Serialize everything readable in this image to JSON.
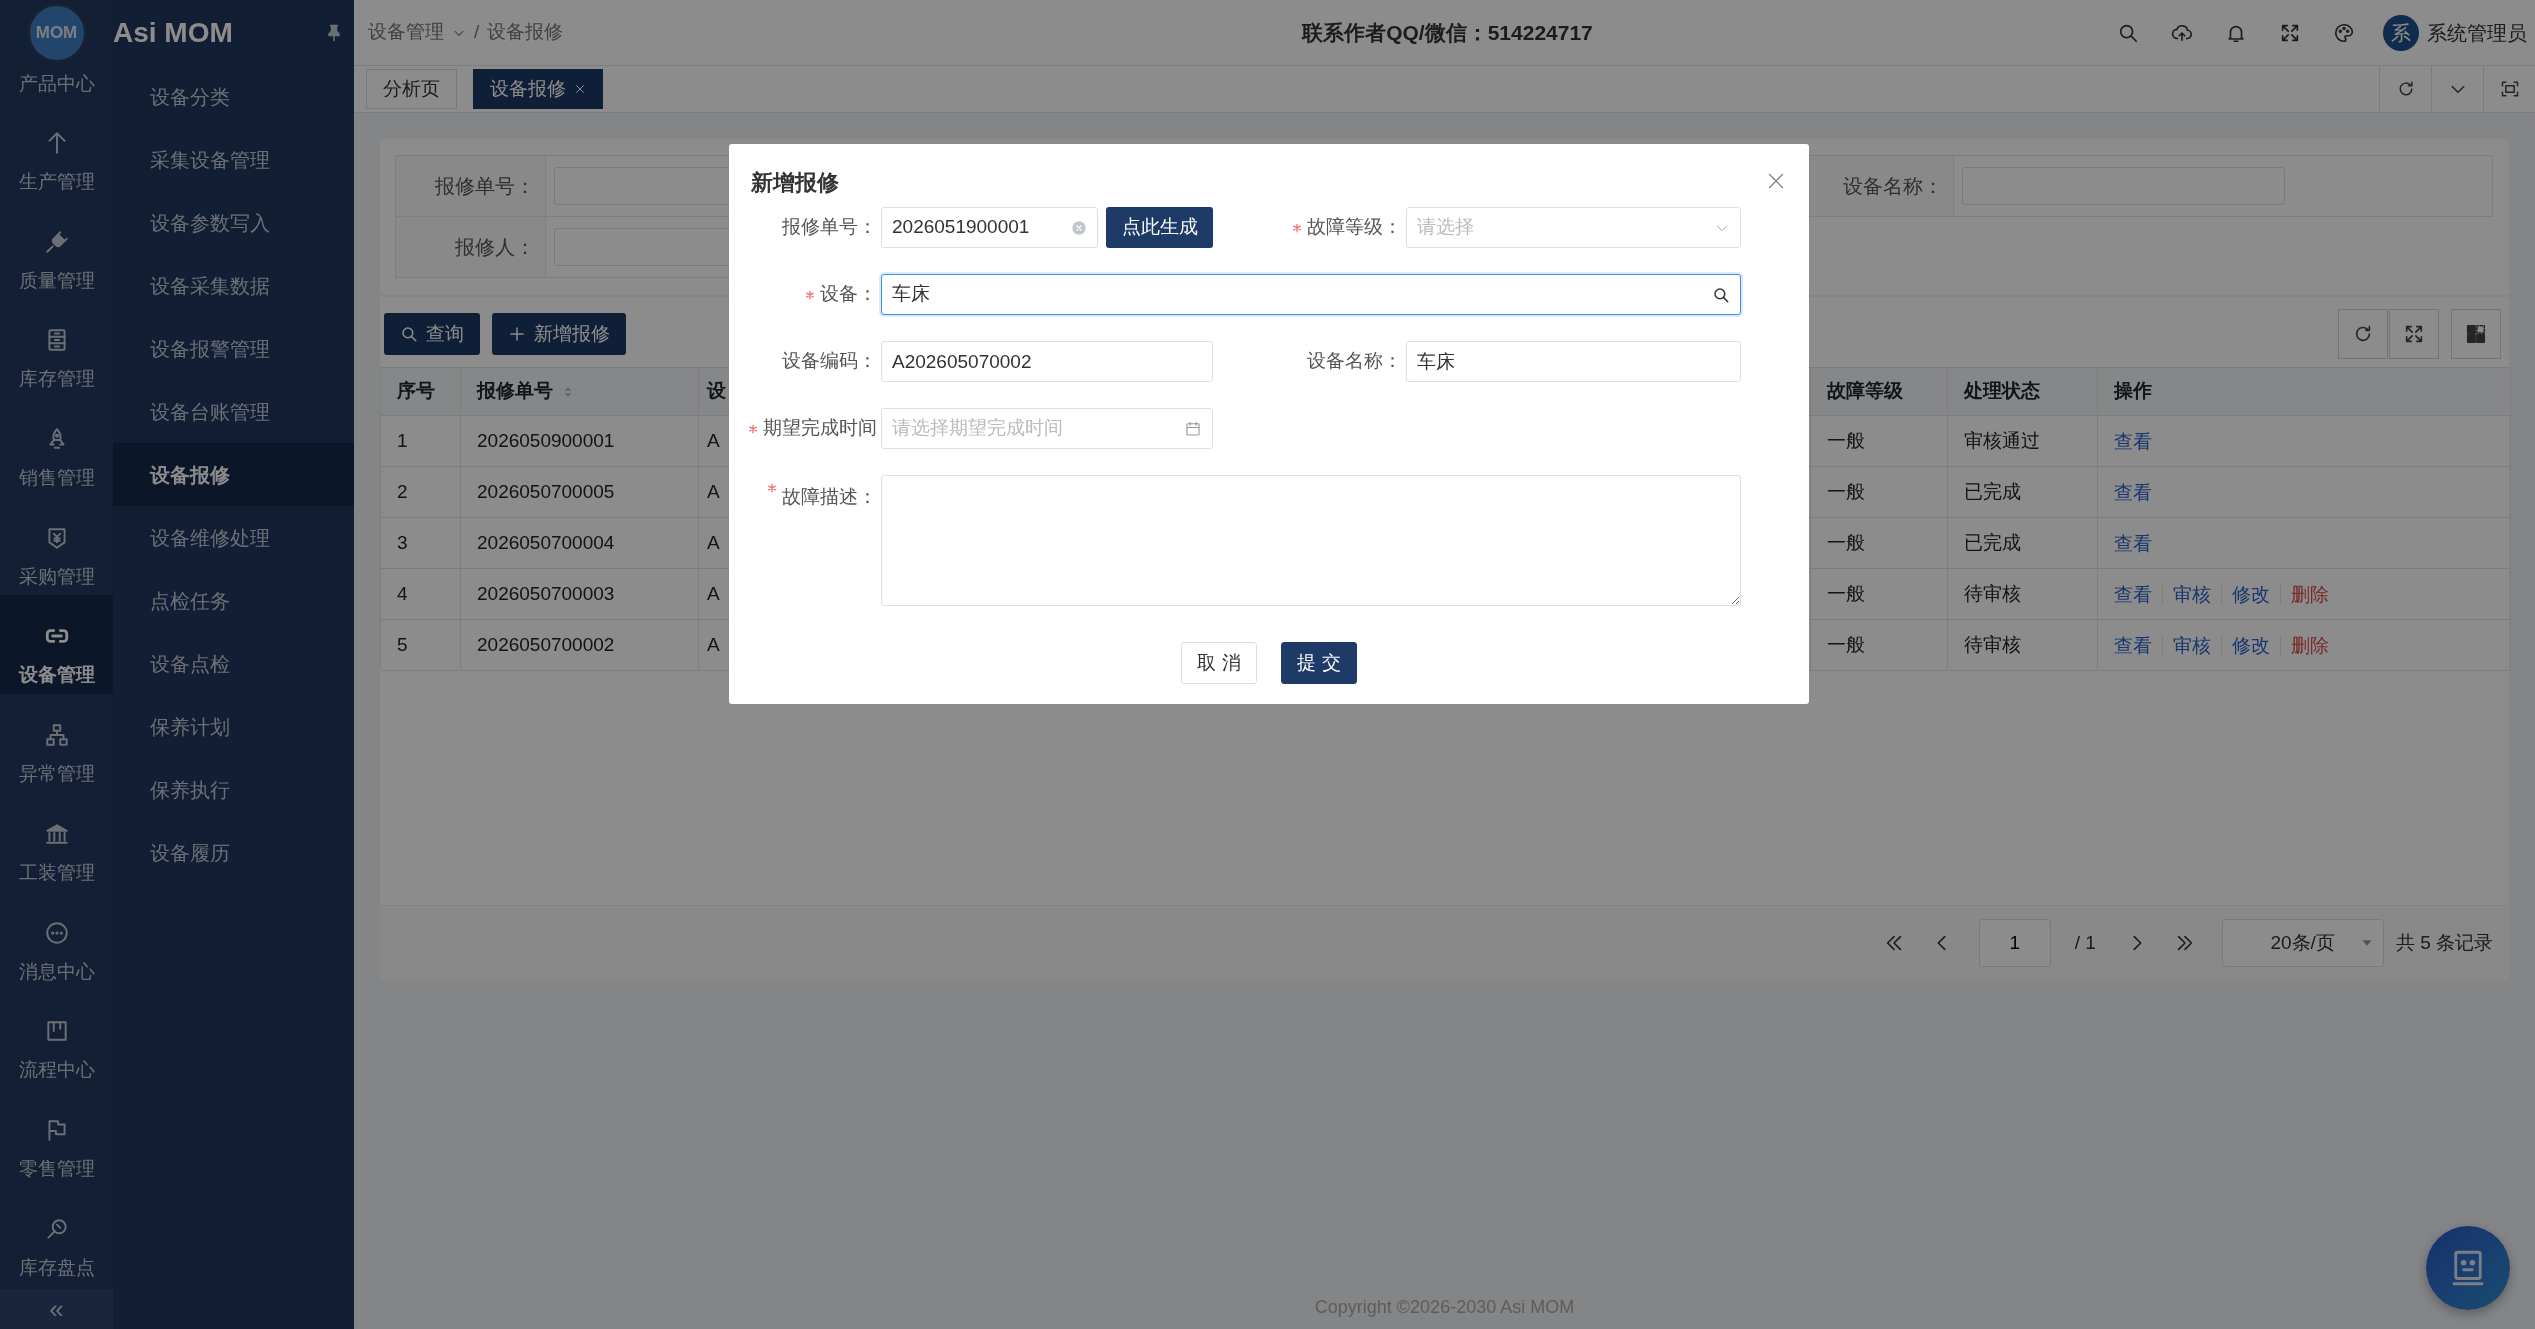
{
  "sidebar": {
    "logo": "MOM",
    "brand": "Asi MOM",
    "rail": [
      {
        "label": "产品中心",
        "selected": false
      },
      {
        "label": "生产管理",
        "selected": false
      },
      {
        "label": "质量管理",
        "selected": false
      },
      {
        "label": "库存管理",
        "selected": false
      },
      {
        "label": "销售管理",
        "selected": false
      },
      {
        "label": "采购管理",
        "selected": false
      },
      {
        "label": "设备管理",
        "selected": true
      },
      {
        "label": "异常管理",
        "selected": false
      },
      {
        "label": "工装管理",
        "selected": false
      },
      {
        "label": "消息中心",
        "selected": false
      },
      {
        "label": "流程中心",
        "selected": false
      },
      {
        "label": "零售管理",
        "selected": false
      },
      {
        "label": "库存盘点",
        "selected": false
      }
    ],
    "collapse": "«",
    "menu": [
      {
        "label": "设备分类",
        "selected": false
      },
      {
        "label": "采集设备管理",
        "selected": false
      },
      {
        "label": "设备参数写入",
        "selected": false
      },
      {
        "label": "设备采集数据",
        "selected": false
      },
      {
        "label": "设备报警管理",
        "selected": false
      },
      {
        "label": "设备台账管理",
        "selected": false
      },
      {
        "label": "设备报修",
        "selected": true
      },
      {
        "label": "设备维修处理",
        "selected": false
      },
      {
        "label": "点检任务",
        "selected": false
      },
      {
        "label": "设备点检",
        "selected": false
      },
      {
        "label": "保养计划",
        "selected": false
      },
      {
        "label": "保养执行",
        "selected": false
      },
      {
        "label": "设备履历",
        "selected": false
      }
    ]
  },
  "header": {
    "breadcrumb": [
      "设备管理",
      "/",
      "设备报修"
    ],
    "notice": "联系作者QQ/微信：514224717",
    "avatar": "系",
    "user": "系统管理员"
  },
  "tabs": [
    {
      "label": "分析页",
      "selected": false,
      "closable": false
    },
    {
      "label": "设备报修",
      "selected": true,
      "closable": true
    }
  ],
  "search_form": {
    "repair_no": {
      "label": "报修单号："
    },
    "equipment_name": {
      "label": "设备名称："
    },
    "reporter": {
      "label": "报修人："
    }
  },
  "actions": [
    {
      "label": "查询"
    },
    {
      "label": "新增报修"
    }
  ],
  "table": {
    "columns": [
      {
        "label": "序号",
        "sortable": false
      },
      {
        "label": "报修单号",
        "sortable": true
      },
      {
        "label": "设",
        "sortable": false
      },
      {
        "label": "故障等级",
        "sortable": false
      },
      {
        "label": "处理状态",
        "sortable": false
      },
      {
        "label": "操作",
        "sortable": false
      }
    ],
    "rows": [
      {
        "cells": [
          "1",
          "2026050900001",
          "A",
          "一般",
          "审核通过"
        ],
        "operations": [
          {
            "label": "查看",
            "kind": "link"
          }
        ]
      },
      {
        "cells": [
          "2",
          "2026050700005",
          "A",
          "一般",
          "已完成"
        ],
        "operations": [
          {
            "label": "查看",
            "kind": "link"
          }
        ]
      },
      {
        "cells": [
          "3",
          "2026050700004",
          "A",
          "一般",
          "已完成"
        ],
        "operations": [
          {
            "label": "查看",
            "kind": "link"
          }
        ]
      },
      {
        "cells": [
          "4",
          "2026050700003",
          "A",
          "一般",
          "待审核"
        ],
        "operations": [
          {
            "label": "查看",
            "kind": "link"
          },
          {
            "label": "审核",
            "kind": "link"
          },
          {
            "label": "修改",
            "kind": "link"
          },
          {
            "label": "删除",
            "kind": "danger"
          }
        ]
      },
      {
        "cells": [
          "5",
          "2026050700002",
          "A",
          "一般",
          "待审核"
        ],
        "operations": [
          {
            "label": "查看",
            "kind": "link"
          },
          {
            "label": "审核",
            "kind": "link"
          },
          {
            "label": "修改",
            "kind": "link"
          },
          {
            "label": "删除",
            "kind": "danger"
          }
        ]
      }
    ]
  },
  "pagination": {
    "page": "1",
    "pages": "/ 1",
    "page_size": "20条/页",
    "total": "共 5 条记录"
  },
  "footer": {
    "copyright": "Copyright ©2026-2030 Asi MOM"
  },
  "dialog": {
    "title": "新增报修",
    "repair_no": {
      "label": "报修单号：",
      "value": "2026051900001",
      "required": false
    },
    "generate_button": "点此生成",
    "fault_level": {
      "label": "故障等级：",
      "placeholder": "请选择",
      "required": true
    },
    "equipment": {
      "label": "设备：",
      "value": "车床",
      "required": true,
      "focused": true
    },
    "equipment_code": {
      "label": "设备编码：",
      "value": "A202605070002",
      "required": false
    },
    "equipment_name": {
      "label": "设备名称：",
      "value": "车床",
      "required": false
    },
    "expected_time": {
      "label": "期望完成时间",
      "placeholder": "请选择期望完成时间",
      "required": true
    },
    "description": {
      "label": "故障描述：",
      "required": true
    },
    "buttons": [
      {
        "label": "取 消",
        "kind": "default"
      },
      {
        "label": "提 交",
        "kind": "primary"
      }
    ]
  }
}
